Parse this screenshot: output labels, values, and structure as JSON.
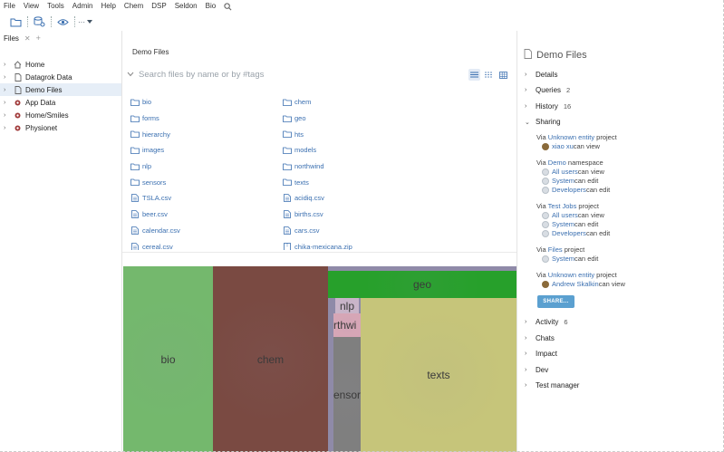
{
  "menubar": [
    "File",
    "View",
    "Tools",
    "Admin",
    "Help",
    "Chem",
    "DSP",
    "Seldon",
    "Bio"
  ],
  "toolbar": {
    "more_label": "···"
  },
  "left": {
    "tab_label": "Files",
    "tree": [
      {
        "label": "Home",
        "icon": "home-icon"
      },
      {
        "label": "Datagrok Data",
        "icon": "file-icon"
      },
      {
        "label": "Demo Files",
        "icon": "file-icon"
      },
      {
        "label": "App Data",
        "icon": "package-icon"
      },
      {
        "label": "Home/Smiles",
        "icon": "package-icon"
      },
      {
        "label": "Physionet",
        "icon": "package-icon"
      }
    ]
  },
  "center": {
    "breadcrumb": "Demo Files",
    "search_placeholder": "Search files by name or by #tags",
    "files_col1": [
      {
        "name": "bio",
        "type": "folder"
      },
      {
        "name": "forms",
        "type": "folder"
      },
      {
        "name": "hierarchy",
        "type": "folder"
      },
      {
        "name": "images",
        "type": "folder"
      },
      {
        "name": "nlp",
        "type": "folder"
      },
      {
        "name": "sensors",
        "type": "folder"
      },
      {
        "name": "TSLA.csv",
        "type": "csv"
      },
      {
        "name": "beer.csv",
        "type": "csv"
      },
      {
        "name": "calendar.csv",
        "type": "csv"
      },
      {
        "name": "cereal.csv",
        "type": "csv"
      }
    ],
    "files_col2": [
      {
        "name": "chem",
        "type": "folder"
      },
      {
        "name": "geo",
        "type": "folder"
      },
      {
        "name": "hts",
        "type": "folder"
      },
      {
        "name": "models",
        "type": "folder"
      },
      {
        "name": "northwind",
        "type": "folder"
      },
      {
        "name": "texts",
        "type": "folder"
      },
      {
        "name": "acidiq.csv",
        "type": "csv"
      },
      {
        "name": "births.csv",
        "type": "csv"
      },
      {
        "name": "cars.csv",
        "type": "csv"
      },
      {
        "name": "chika-mexicana.zip",
        "type": "zip"
      }
    ],
    "treemap": [
      {
        "label": "bio",
        "color": "#74b86d"
      },
      {
        "label": "chem",
        "color": "#7a4a42"
      },
      {
        "label": "geo",
        "color": "#27a02b"
      },
      {
        "label": "nlp",
        "color": "#c9b5c9"
      },
      {
        "label": "rthwi",
        "color": "#d6a6b6"
      },
      {
        "label": "ensor",
        "color": "#7f7f7f"
      },
      {
        "label": "texts",
        "color": "#c6c57a"
      }
    ]
  },
  "right": {
    "title": "Demo Files",
    "sections": [
      {
        "label": "Details",
        "count": ""
      },
      {
        "label": "Queries",
        "count": "2"
      },
      {
        "label": "History",
        "count": "16"
      },
      {
        "label": "Sharing",
        "count": ""
      }
    ],
    "sharing": [
      {
        "via_prefix": "Via ",
        "via_link": "Unknown entity",
        "via_suffix": " project",
        "rows": [
          {
            "who": "xiao xu",
            "perm": " can view",
            "icon": "user-avatar-icon"
          }
        ]
      },
      {
        "via_prefix": "Via ",
        "via_link": "Demo",
        "via_suffix": " namespace",
        "rows": [
          {
            "who": "All users",
            "perm": " can view",
            "icon": "group-icon"
          },
          {
            "who": "System",
            "perm": " can edit",
            "icon": "group-icon"
          },
          {
            "who": "Developers",
            "perm": " can edit",
            "icon": "group-icon"
          }
        ]
      },
      {
        "via_prefix": "Via ",
        "via_link": "Test Jobs",
        "via_suffix": " project",
        "rows": [
          {
            "who": "All users",
            "perm": " can view",
            "icon": "group-icon"
          },
          {
            "who": "System",
            "perm": " can edit",
            "icon": "group-icon"
          },
          {
            "who": "Developers",
            "perm": " can edit",
            "icon": "group-icon"
          }
        ]
      },
      {
        "via_prefix": "Via ",
        "via_link": "Files",
        "via_suffix": " project",
        "rows": [
          {
            "who": "System",
            "perm": " can edit",
            "icon": "group-icon"
          }
        ]
      },
      {
        "via_prefix": "Via ",
        "via_link": "Unknown entity",
        "via_suffix": " project",
        "rows": [
          {
            "who": "Andrew Skalkin",
            "perm": " can view",
            "icon": "user-avatar-icon"
          }
        ]
      }
    ],
    "share_button": "SHARE...",
    "sections_after": [
      {
        "label": "Activity",
        "count": "6"
      },
      {
        "label": "Chats",
        "count": ""
      },
      {
        "label": "Impact",
        "count": ""
      },
      {
        "label": "Dev",
        "count": ""
      },
      {
        "label": "Test manager",
        "count": ""
      }
    ]
  }
}
